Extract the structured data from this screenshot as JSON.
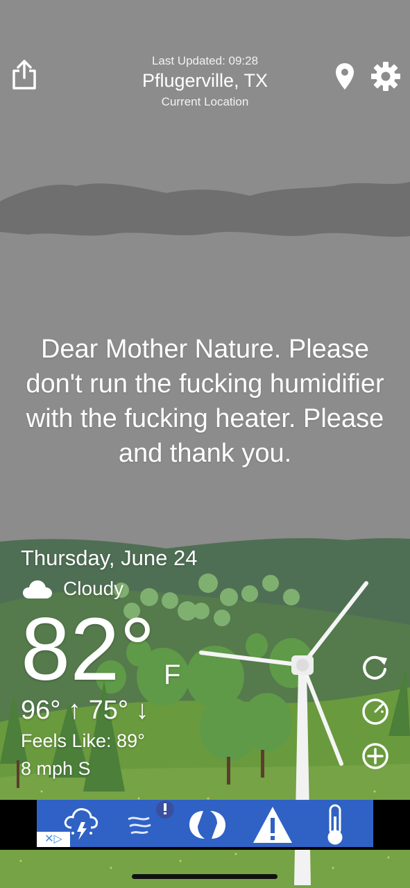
{
  "header": {
    "last_updated": "Last Updated: 09:28",
    "location": "Pflugerville, TX",
    "location_sub": "Current Location",
    "share_icon": "share-icon",
    "pin_icon": "location-pin-icon",
    "settings_icon": "gear-icon"
  },
  "message": "Dear Mother Nature. Please don't run the fucking humidifier with the fucking heater. Please and thank you.",
  "weather": {
    "date": "Thursday, June 24",
    "condition": "Cloudy",
    "condition_icon": "cloud-icon",
    "temperature": "82°",
    "unit": "F",
    "hi_lo": "96° ↑ 75° ↓",
    "feels_like": "Feels Like: 89°",
    "wind": "8 mph S"
  },
  "side_buttons": [
    "refresh-icon",
    "radar-icon",
    "add-icon"
  ],
  "ad": {
    "icons": [
      "storm-icon",
      "wind-alert-icon",
      "hurricane-icon",
      "warning-icon",
      "thermometer-icon"
    ],
    "badge_text": "✕▷"
  },
  "colors": {
    "sky": "#8c8c8c",
    "cloud_band": "#6f6f6f",
    "hill_far": "#4a6b52",
    "ground": "#6a9a3e",
    "ad_blue": "#2f62c4"
  }
}
